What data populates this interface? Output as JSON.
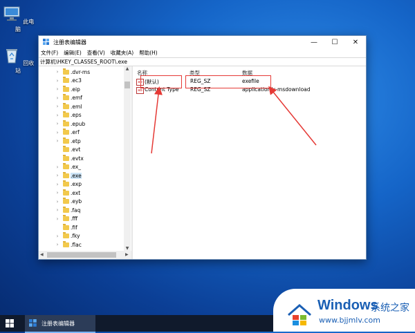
{
  "desktop": {
    "icons": [
      {
        "label": "此电脑",
        "icon": "computer-icon"
      },
      {
        "label": "回收站",
        "icon": "recycle-bin-icon"
      }
    ]
  },
  "window": {
    "title": "注册表编辑器",
    "controls": {
      "minimize": "—",
      "maximize": "☐",
      "close": "✕"
    },
    "menu": [
      "文件(F)",
      "编辑(E)",
      "查看(V)",
      "收藏夹(A)",
      "帮助(H)"
    ],
    "address": "计算机\\HKEY_CLASSES_ROOT\\.exe",
    "tree": [
      {
        "name": ".dvr-ms",
        "expand": "›"
      },
      {
        "name": ".ec3",
        "expand": "›"
      },
      {
        "name": ".eip",
        "expand": "›"
      },
      {
        "name": ".emf",
        "expand": "›"
      },
      {
        "name": ".eml",
        "expand": "›"
      },
      {
        "name": ".eps",
        "expand": "›"
      },
      {
        "name": ".epub",
        "expand": "›"
      },
      {
        "name": ".erf",
        "expand": "›"
      },
      {
        "name": ".etp",
        "expand": "›"
      },
      {
        "name": ".evt",
        "expand": ""
      },
      {
        "name": ".evtx",
        "expand": ""
      },
      {
        "name": ".ex_",
        "expand": "›"
      },
      {
        "name": ".exe",
        "expand": "›",
        "selected": true
      },
      {
        "name": ".exp",
        "expand": "›"
      },
      {
        "name": ".ext",
        "expand": "›"
      },
      {
        "name": ".eyb",
        "expand": "›"
      },
      {
        "name": ".faq",
        "expand": "›"
      },
      {
        "name": ".fff",
        "expand": "›"
      },
      {
        "name": ".fif",
        "expand": ""
      },
      {
        "name": ".fky",
        "expand": "›"
      },
      {
        "name": ".flac",
        "expand": "›"
      }
    ],
    "columns": {
      "name": "名称",
      "type": "类型",
      "data": "数据"
    },
    "rows": [
      {
        "icon": "ab",
        "name": "(默认)",
        "type": "REG_SZ",
        "data": "exefile"
      },
      {
        "icon": "ab",
        "name": "Content Type",
        "type": "REG_SZ",
        "data": "application/x-msdownload"
      }
    ]
  },
  "taskbar": {
    "app_label": "注册表编辑器"
  },
  "watermark": {
    "brand": "Windows",
    "suffix": "系统之家",
    "url": "www.bjjmlv.com"
  },
  "colors": {
    "highlight": "#e53935",
    "selection": "#cce4f7",
    "accent": "#1a5fb4"
  }
}
